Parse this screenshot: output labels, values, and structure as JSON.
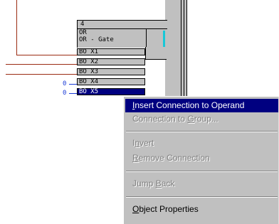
{
  "block": {
    "number": "4",
    "type": "OR",
    "name": "OR - Gate"
  },
  "operands": [
    {
      "label": "BO X1",
      "negated": false,
      "selected": false
    },
    {
      "label": "BO X2",
      "negated": false,
      "selected": false
    },
    {
      "label": "BO X3",
      "negated": false,
      "selected": false
    },
    {
      "label": "BO X4",
      "negated": true,
      "selected": false
    },
    {
      "label": "BO X5",
      "negated": true,
      "selected": true
    }
  ],
  "negation_marker": "0",
  "colors": {
    "wire": "#9a2b12",
    "negated_wire": "#1a3bd6",
    "selection": "#000080",
    "menu_bg": "#c0c0c0"
  },
  "context_menu": {
    "items": [
      {
        "pre": "",
        "key": "I",
        "post": "nsert Connection to Operand",
        "enabled": true,
        "highlighted": true
      },
      {
        "pre": "Connection to ",
        "key": "G",
        "post": "roup...",
        "enabled": false
      },
      {
        "pre": "I",
        "key": "n",
        "post": "vert",
        "enabled": false
      },
      {
        "pre": "",
        "key": "R",
        "post": "emove Connection",
        "enabled": false
      },
      {
        "pre": "Jump ",
        "key": "B",
        "post": "ack",
        "enabled": false
      },
      {
        "pre": "",
        "key": "O",
        "post": "bject Properties",
        "enabled": true
      }
    ]
  }
}
